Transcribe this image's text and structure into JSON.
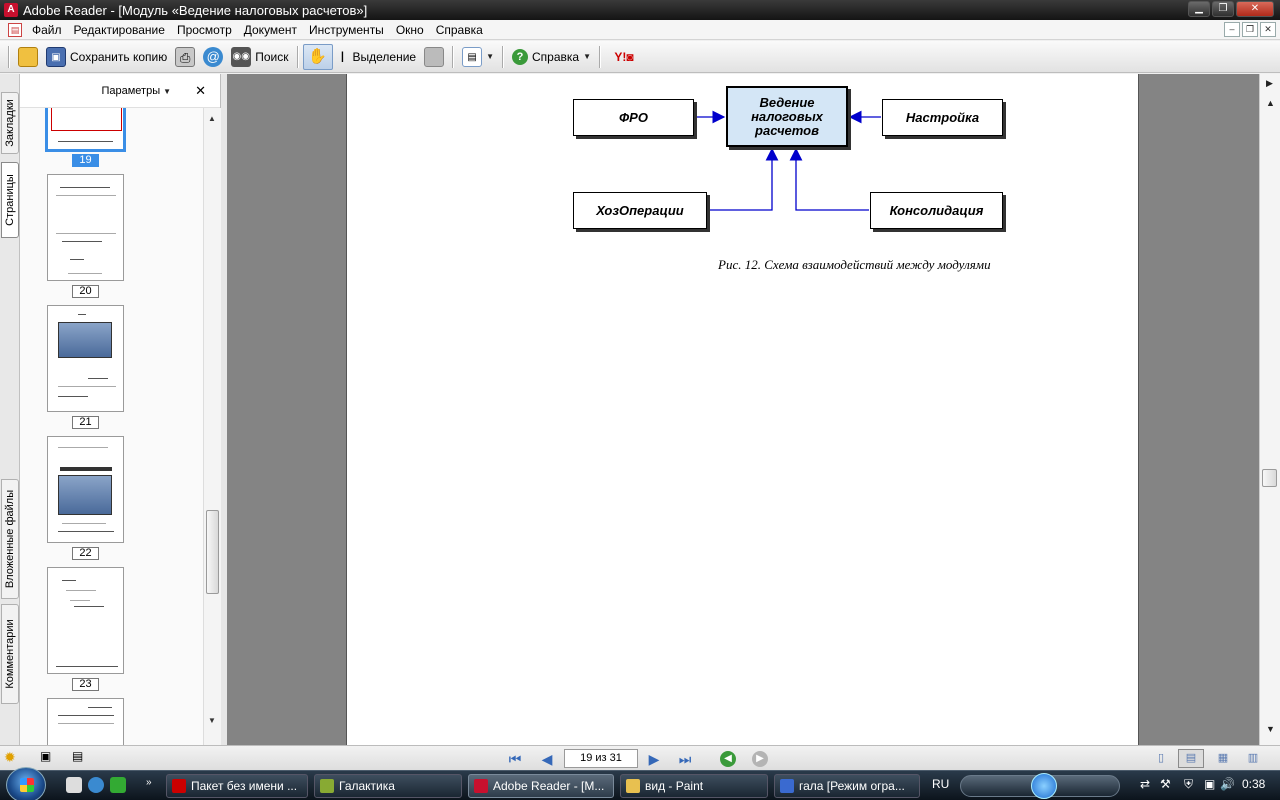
{
  "window": {
    "title": "Adobe Reader - [Модуль «Ведение налоговых расчетов»]",
    "app_icon": "adobe-reader-icon"
  },
  "menu": {
    "items": [
      "Файл",
      "Редактирование",
      "Просмотр",
      "Документ",
      "Инструменты",
      "Окно",
      "Справка"
    ]
  },
  "toolbar": {
    "save_copy_label": "Сохранить копию",
    "search_label": "Поиск",
    "select_label": "Выделение",
    "help_label": "Справка"
  },
  "side_tabs": [
    "Закладки",
    "Страницы",
    "Вложенные файлы",
    "Комментарии"
  ],
  "pages_panel": {
    "options_label": "Параметры",
    "thumbnails": [
      {
        "label": "19",
        "selected": true
      },
      {
        "label": "20",
        "selected": false
      },
      {
        "label": "21",
        "selected": false
      },
      {
        "label": "22",
        "selected": false
      },
      {
        "label": "23",
        "selected": false
      }
    ]
  },
  "diagram": {
    "center": "Ведение налоговых расчетов",
    "nodes": {
      "fro": "ФРО",
      "settings": "Настройка",
      "ops": "ХозОперации",
      "consolidation": "Консолидация"
    },
    "caption": "Рис. 12. Схема взаимодействий между модулями",
    "center_fill": "#d4e6f6",
    "arrow_color": "#0000cc"
  },
  "status": {
    "page_indicator": "19 из 31"
  },
  "taskbar": {
    "tasks": [
      {
        "label": "Пакет без имени ...",
        "active": false
      },
      {
        "label": "Галактика",
        "active": false
      },
      {
        "label": "Adobe Reader - [М...",
        "active": true
      },
      {
        "label": "вид - Paint",
        "active": false
      },
      {
        "label": "гала [Режим огра...",
        "active": false
      }
    ],
    "language": "RU",
    "clock": "0:38"
  }
}
